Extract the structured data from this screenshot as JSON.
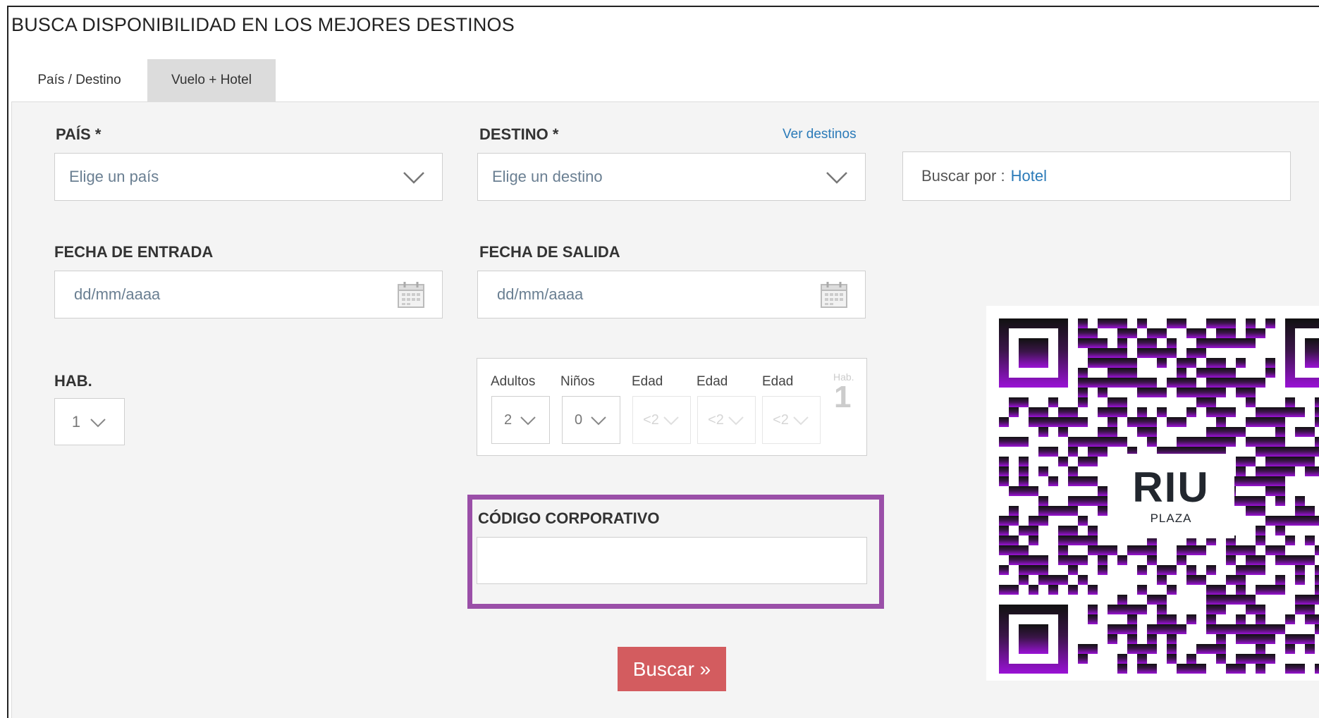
{
  "header": {
    "title": "BUSCA DISPONIBILIDAD EN LOS MEJORES DESTINOS"
  },
  "tabs": [
    {
      "label": "País / Destino",
      "active": true
    },
    {
      "label": "Vuelo + Hotel",
      "active": false
    }
  ],
  "form": {
    "pais": {
      "label": "PAÍS *",
      "placeholder": "Elige un país"
    },
    "destino": {
      "label": "DESTINO *",
      "placeholder": "Elige un destino",
      "link": "Ver destinos"
    },
    "buscar_por": {
      "prefix": "Buscar por : ",
      "value": "Hotel"
    },
    "fecha_entrada": {
      "label": "FECHA DE ENTRADA",
      "placeholder": "dd/mm/aaaa"
    },
    "fecha_salida": {
      "label": "FECHA DE SALIDA",
      "placeholder": "dd/mm/aaaa"
    },
    "hab": {
      "label": "HAB.",
      "value": "1"
    },
    "occupancy": {
      "headers": [
        "Adultos",
        "Niños",
        "Edad",
        "Edad",
        "Edad"
      ],
      "adultos_value": "2",
      "ninos_value": "0",
      "edad_value": "<2",
      "hab_label": "Hab.",
      "hab_number": "1"
    },
    "corporate": {
      "label": "CÓDIGO CORPORATIVO",
      "value": ""
    },
    "submit_label": "Buscar »"
  },
  "qr": {
    "logo_text": "RIU",
    "logo_subtext": "PLAZA"
  },
  "colors": {
    "link": "#2a7ab8",
    "button": "#d35c5f",
    "highlight": "#9a4fa8",
    "panel": "#f4f4f4"
  },
  "icons": [
    "chevron-down-icon",
    "calendar-icon"
  ]
}
